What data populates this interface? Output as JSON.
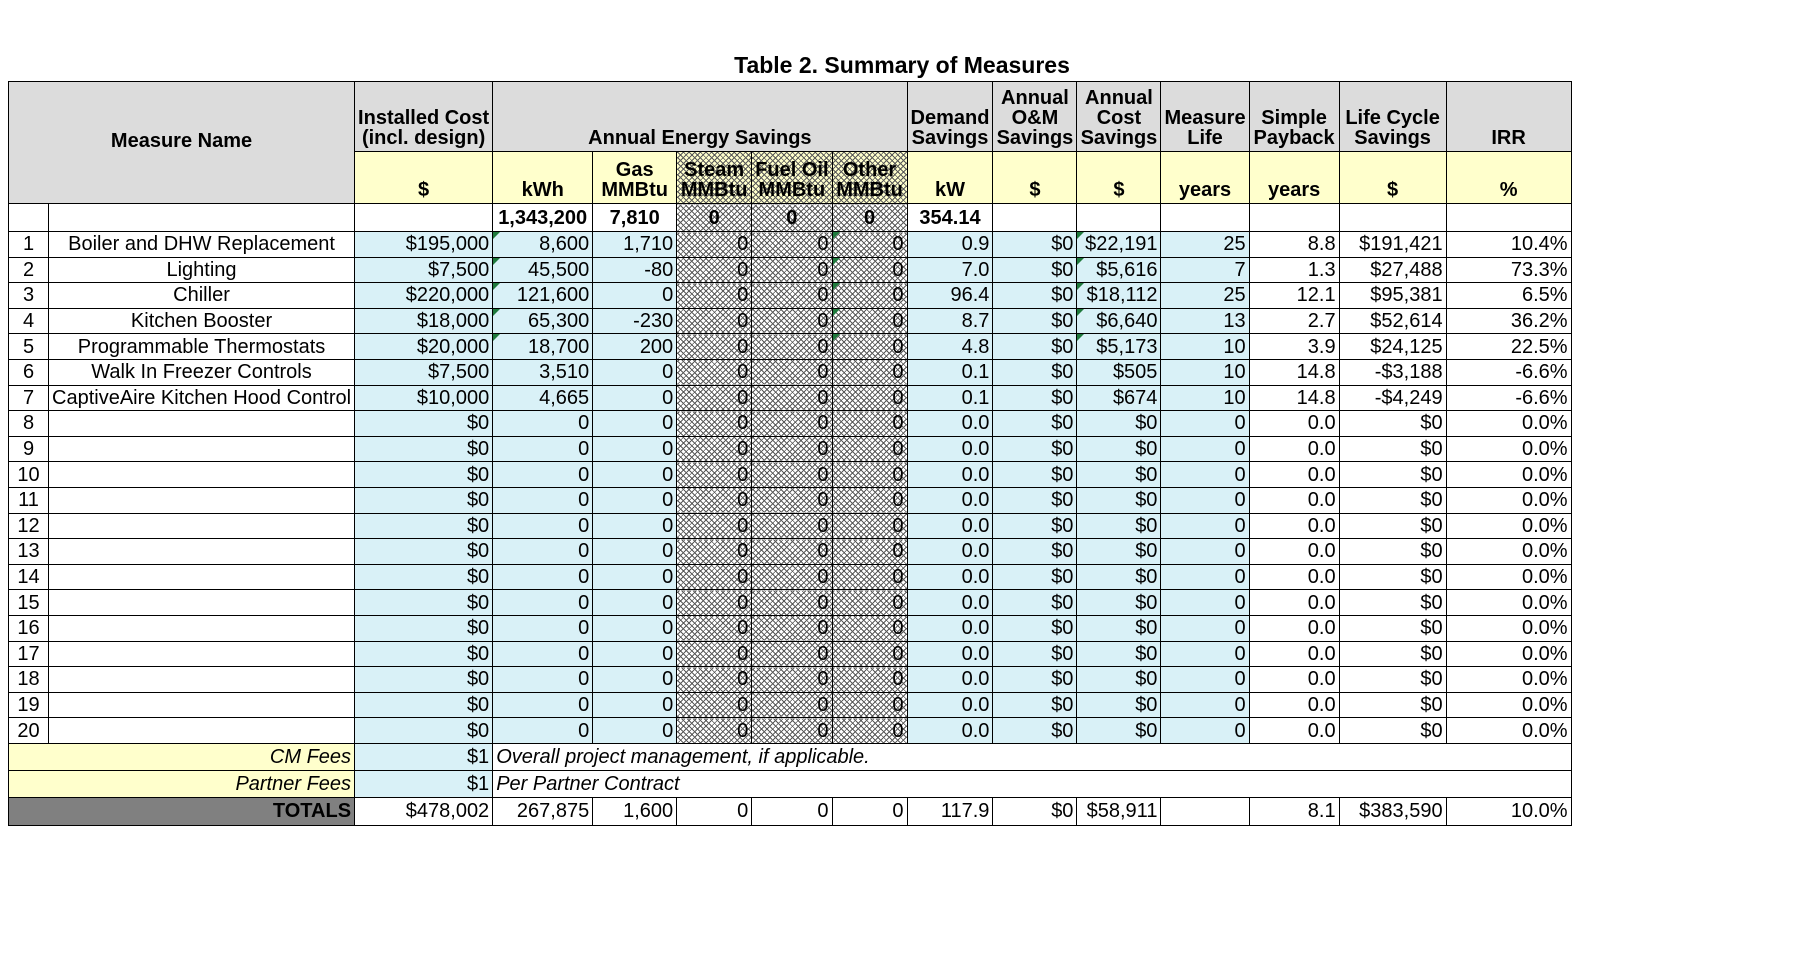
{
  "title": "Table 2.  Summary of Measures",
  "headers": {
    "measure_name": "Measure Name",
    "installed_cost_l1": "Installed Cost",
    "installed_cost_l2": "(incl. design)",
    "annual_energy_savings": "Annual Energy Savings",
    "demand_l1": "Demand",
    "demand_l2": "Savings",
    "om_l1": "Annual",
    "om_l2": "O&M",
    "om_l3": "Savings",
    "cost_l1": "Annual",
    "cost_l2": "Cost",
    "cost_l3": "Savings",
    "life_l1": "Measure",
    "life_l2": "Life",
    "payback_l1": "Simple",
    "payback_l2": "Payback",
    "lcs_l1": "Life Cycle",
    "lcs_l2": "Savings",
    "irr": "IRR"
  },
  "units": {
    "cost": "$",
    "kwh": "kWh",
    "gas_l1": "Gas",
    "gas_l2": "MMBtu",
    "steam_l1": "Steam",
    "steam_l2": "MMBtu",
    "fuel_l1": "Fuel Oil",
    "fuel_l2": "MMBtu",
    "other_l1": "Other",
    "other_l2": "MMBtu",
    "kw": "kW",
    "om": "$",
    "costsav": "$",
    "life": "years",
    "payback": "years",
    "lcs": "$",
    "irr": "%"
  },
  "baseline": {
    "kwh": "1,343,200",
    "gas": "7,810",
    "steam": "0",
    "fuel": "0",
    "other": "0",
    "kw": "354.14"
  },
  "rows": [
    {
      "n": "1",
      "name": "Boiler and DHW Replacement",
      "cost": "$195,000",
      "kwh": "8,600",
      "gas": "1,710",
      "steam": "0",
      "fuel": "0",
      "other": "0",
      "kw": "0.9",
      "om": "$0",
      "sav": "$22,191",
      "life": "25",
      "payback": "8.8",
      "lcs": "$191,421",
      "irr": "10.4%"
    },
    {
      "n": "2",
      "name": "Lighting",
      "cost": "$7,500",
      "kwh": "45,500",
      "gas": "-80",
      "steam": "0",
      "fuel": "0",
      "other": "0",
      "kw": "7.0",
      "om": "$0",
      "sav": "$5,616",
      "life": "7",
      "payback": "1.3",
      "lcs": "$27,488",
      "irr": "73.3%"
    },
    {
      "n": "3",
      "name": "Chiller",
      "cost": "$220,000",
      "kwh": "121,600",
      "gas": "0",
      "steam": "0",
      "fuel": "0",
      "other": "0",
      "kw": "96.4",
      "om": "$0",
      "sav": "$18,112",
      "life": "25",
      "payback": "12.1",
      "lcs": "$95,381",
      "irr": "6.5%"
    },
    {
      "n": "4",
      "name": "Kitchen Booster",
      "cost": "$18,000",
      "kwh": "65,300",
      "gas": "-230",
      "steam": "0",
      "fuel": "0",
      "other": "0",
      "kw": "8.7",
      "om": "$0",
      "sav": "$6,640",
      "life": "13",
      "payback": "2.7",
      "lcs": "$52,614",
      "irr": "36.2%"
    },
    {
      "n": "5",
      "name": "Programmable Thermostats",
      "cost": "$20,000",
      "kwh": "18,700",
      "gas": "200",
      "steam": "0",
      "fuel": "0",
      "other": "0",
      "kw": "4.8",
      "om": "$0",
      "sav": "$5,173",
      "life": "10",
      "payback": "3.9",
      "lcs": "$24,125",
      "irr": "22.5%"
    },
    {
      "n": "6",
      "name": "Walk In Freezer Controls",
      "cost": "$7,500",
      "kwh": "3,510",
      "gas": "0",
      "steam": "0",
      "fuel": "0",
      "other": "0",
      "kw": "0.1",
      "om": "$0",
      "sav": "$505",
      "life": "10",
      "payback": "14.8",
      "lcs": "-$3,188",
      "irr": "-6.6%"
    },
    {
      "n": "7",
      "name": "CaptiveAire Kitchen Hood Control",
      "cost": "$10,000",
      "kwh": "4,665",
      "gas": "0",
      "steam": "0",
      "fuel": "0",
      "other": "0",
      "kw": "0.1",
      "om": "$0",
      "sav": "$674",
      "life": "10",
      "payback": "14.8",
      "lcs": "-$4,249",
      "irr": "-6.6%"
    },
    {
      "n": "8",
      "name": "",
      "cost": "$0",
      "kwh": "0",
      "gas": "0",
      "steam": "0",
      "fuel": "0",
      "other": "0",
      "kw": "0.0",
      "om": "$0",
      "sav": "$0",
      "life": "0",
      "payback": "0.0",
      "lcs": "$0",
      "irr": "0.0%"
    },
    {
      "n": "9",
      "name": "",
      "cost": "$0",
      "kwh": "0",
      "gas": "0",
      "steam": "0",
      "fuel": "0",
      "other": "0",
      "kw": "0.0",
      "om": "$0",
      "sav": "$0",
      "life": "0",
      "payback": "0.0",
      "lcs": "$0",
      "irr": "0.0%"
    },
    {
      "n": "10",
      "name": "",
      "cost": "$0",
      "kwh": "0",
      "gas": "0",
      "steam": "0",
      "fuel": "0",
      "other": "0",
      "kw": "0.0",
      "om": "$0",
      "sav": "$0",
      "life": "0",
      "payback": "0.0",
      "lcs": "$0",
      "irr": "0.0%"
    },
    {
      "n": "11",
      "name": "",
      "cost": "$0",
      "kwh": "0",
      "gas": "0",
      "steam": "0",
      "fuel": "0",
      "other": "0",
      "kw": "0.0",
      "om": "$0",
      "sav": "$0",
      "life": "0",
      "payback": "0.0",
      "lcs": "$0",
      "irr": "0.0%"
    },
    {
      "n": "12",
      "name": "",
      "cost": "$0",
      "kwh": "0",
      "gas": "0",
      "steam": "0",
      "fuel": "0",
      "other": "0",
      "kw": "0.0",
      "om": "$0",
      "sav": "$0",
      "life": "0",
      "payback": "0.0",
      "lcs": "$0",
      "irr": "0.0%"
    },
    {
      "n": "13",
      "name": "",
      "cost": "$0",
      "kwh": "0",
      "gas": "0",
      "steam": "0",
      "fuel": "0",
      "other": "0",
      "kw": "0.0",
      "om": "$0",
      "sav": "$0",
      "life": "0",
      "payback": "0.0",
      "lcs": "$0",
      "irr": "0.0%"
    },
    {
      "n": "14",
      "name": "",
      "cost": "$0",
      "kwh": "0",
      "gas": "0",
      "steam": "0",
      "fuel": "0",
      "other": "0",
      "kw": "0.0",
      "om": "$0",
      "sav": "$0",
      "life": "0",
      "payback": "0.0",
      "lcs": "$0",
      "irr": "0.0%"
    },
    {
      "n": "15",
      "name": "",
      "cost": "$0",
      "kwh": "0",
      "gas": "0",
      "steam": "0",
      "fuel": "0",
      "other": "0",
      "kw": "0.0",
      "om": "$0",
      "sav": "$0",
      "life": "0",
      "payback": "0.0",
      "lcs": "$0",
      "irr": "0.0%"
    },
    {
      "n": "16",
      "name": "",
      "cost": "$0",
      "kwh": "0",
      "gas": "0",
      "steam": "0",
      "fuel": "0",
      "other": "0",
      "kw": "0.0",
      "om": "$0",
      "sav": "$0",
      "life": "0",
      "payback": "0.0",
      "lcs": "$0",
      "irr": "0.0%"
    },
    {
      "n": "17",
      "name": "",
      "cost": "$0",
      "kwh": "0",
      "gas": "0",
      "steam": "0",
      "fuel": "0",
      "other": "0",
      "kw": "0.0",
      "om": "$0",
      "sav": "$0",
      "life": "0",
      "payback": "0.0",
      "lcs": "$0",
      "irr": "0.0%"
    },
    {
      "n": "18",
      "name": "",
      "cost": "$0",
      "kwh": "0",
      "gas": "0",
      "steam": "0",
      "fuel": "0",
      "other": "0",
      "kw": "0.0",
      "om": "$0",
      "sav": "$0",
      "life": "0",
      "payback": "0.0",
      "lcs": "$0",
      "irr": "0.0%"
    },
    {
      "n": "19",
      "name": "",
      "cost": "$0",
      "kwh": "0",
      "gas": "0",
      "steam": "0",
      "fuel": "0",
      "other": "0",
      "kw": "0.0",
      "om": "$0",
      "sav": "$0",
      "life": "0",
      "payback": "0.0",
      "lcs": "$0",
      "irr": "0.0%"
    },
    {
      "n": "20",
      "name": "",
      "cost": "$0",
      "kwh": "0",
      "gas": "0",
      "steam": "0",
      "fuel": "0",
      "other": "0",
      "kw": "0.0",
      "om": "$0",
      "sav": "$0",
      "life": "0",
      "payback": "0.0",
      "lcs": "$0",
      "irr": "0.0%"
    }
  ],
  "fees": [
    {
      "label": "CM Fees",
      "value": "$1",
      "note": "Overall project management, if applicable."
    },
    {
      "label": "Partner Fees",
      "value": "$1",
      "note": "Per Partner Contract"
    }
  ],
  "totals": {
    "label": "TOTALS",
    "cost": "$478,002",
    "kwh": "267,875",
    "gas": "1,600",
    "steam": "0",
    "fuel": "0",
    "other": "0",
    "kw": "117.9",
    "om": "$0",
    "sav": "$58,911",
    "life": "",
    "payback": "8.1",
    "lcs": "$383,590",
    "irr": "10.0%"
  },
  "colors": {
    "header_gray": "#dcdcdc",
    "unit_yellow": "#ffffcc",
    "input_blue": "#d9f1f7",
    "totals_gray": "#808080",
    "indicator_green": "#1f7a3c"
  }
}
